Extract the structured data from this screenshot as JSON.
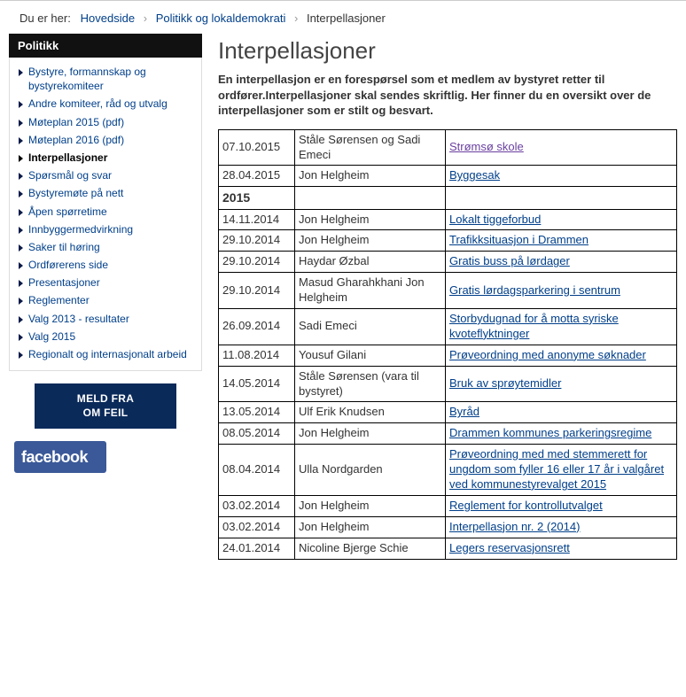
{
  "breadcrumb": {
    "label": "Du er her:",
    "items": [
      "Hovedside",
      "Politikk og lokaldemokrati",
      "Interpellasjoner"
    ]
  },
  "sidebar": {
    "title": "Politikk",
    "items": [
      {
        "label": "Bystyre, formannskap og bystyrekomiteer",
        "current": false
      },
      {
        "label": "Andre komiteer, råd og utvalg",
        "current": false
      },
      {
        "label": "Møteplan 2015 (pdf)",
        "current": false
      },
      {
        "label": "Møteplan 2016 (pdf)",
        "current": false
      },
      {
        "label": "Interpellasjoner",
        "current": true
      },
      {
        "label": "Spørsmål og svar",
        "current": false
      },
      {
        "label": "Bystyremøte på nett",
        "current": false
      },
      {
        "label": "Åpen spørretime",
        "current": false
      },
      {
        "label": "Innbyggermedvirkning",
        "current": false
      },
      {
        "label": "Saker til høring",
        "current": false
      },
      {
        "label": "Ordførerens side",
        "current": false
      },
      {
        "label": "Presentasjoner",
        "current": false
      },
      {
        "label": "Reglementer",
        "current": false
      },
      {
        "label": "Valg 2013 - resultater",
        "current": false
      },
      {
        "label": "Valg 2015",
        "current": false
      },
      {
        "label": "Regionalt og internasjonalt arbeid",
        "current": false
      }
    ],
    "meld_button_line1": "MELD FRA",
    "meld_button_line2": "OM FEIL",
    "facebook_label": "facebook"
  },
  "main": {
    "title": "Interpellasjoner",
    "intro": "En interpellasjon er en forespørsel som et medlem av bystyret retter til ordfører.Interpellasjoner skal sendes skriftlig. Her finner du en oversikt over de interpellasjoner som er stilt og besvart.",
    "rows": [
      {
        "date": "07.10.2015",
        "person": "Ståle Sørensen og Sadi Emeci",
        "topic": "Strømsø skole",
        "visited": true
      },
      {
        "date": "28.04.2015",
        "person": "Jon Helgheim",
        "topic": "Byggesak"
      },
      {
        "year_header": "2015"
      },
      {
        "date": "14.11.2014",
        "person": "Jon Helgheim",
        "topic": "Lokalt tiggeforbud"
      },
      {
        "date": "29.10.2014",
        "person": "Jon Helgheim",
        "topic": "Trafikksituasjon i Drammen"
      },
      {
        "date": "29.10.2014",
        "person": "Haydar Øzbal",
        "topic": "Gratis buss på lørdager"
      },
      {
        "date": "29.10.2014",
        "person": "Masud Gharahkhani Jon Helgheim",
        "topic": "Gratis lørdagsparkering i sentrum"
      },
      {
        "date": "26.09.2014",
        "person": "Sadi Emeci",
        "topic": "Storbydugnad for å motta syriske kvoteflyktninger"
      },
      {
        "date": "11.08.2014",
        "person": "Yousuf Gilani",
        "topic": "Prøveordning med anonyme søknader"
      },
      {
        "date": "14.05.2014",
        "person": "Ståle Sørensen (vara til bystyret)",
        "topic": "Bruk av sprøytemidler"
      },
      {
        "date": "13.05.2014",
        "person": "Ulf Erik Knudsen",
        "topic": "Byråd"
      },
      {
        "date": "08.05.2014",
        "person": "Jon Helgheim",
        "topic": "Drammen kommunes parkeringsregime"
      },
      {
        "date": "08.04.2014",
        "person": "Ulla Nordgarden",
        "topic": "Prøveordning med med stemmerett for ungdom som fyller 16 eller 17 år i valgåret ved kommunestyrevalget 2015"
      },
      {
        "date": "03.02.2014",
        "person": "Jon Helgheim",
        "topic": "Reglement for kontrollutvalget"
      },
      {
        "date": "03.02.2014",
        "person": "Jon Helgheim",
        "topic": "Interpellasjon nr. 2 (2014)"
      },
      {
        "date": "24.01.2014",
        "person": "Nicoline Bjerge Schie",
        "topic": "Legers reservasjonsrett"
      }
    ]
  }
}
